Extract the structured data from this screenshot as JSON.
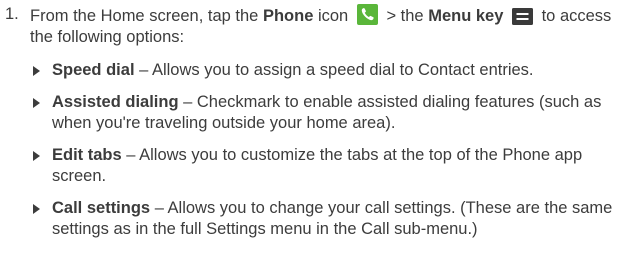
{
  "step": {
    "number": "1.",
    "intro_before_phone": "From the Home screen, tap the",
    "phone_label": "Phone",
    "icon_word": "icon",
    "arrow_text": "> the",
    "menu_key_label": "Menu key",
    "intro_after_menu": "to access the following options:",
    "phone_icon": "phone-icon",
    "menu_icon": "menu-key-icon"
  },
  "colors": {
    "phone_icon_bg": "#5ab63a",
    "menu_icon_bg": "#3a3a3a",
    "text": "#3c3c3c"
  },
  "options": [
    {
      "title": "Speed dial",
      "description": " – Allows you to assign a speed dial to Contact entries."
    },
    {
      "title": "Assisted dialing",
      "description": " – Checkmark to enable assisted dialing features (such as when you're traveling outside your home area)."
    },
    {
      "title": "Edit tabs",
      "description": " – Allows you to customize the tabs at the top of the Phone app screen."
    },
    {
      "title": "Call settings",
      "description": " – Allows you to change your call settings. (These are the same settings as in the full Settings menu in the Call sub-menu.)"
    }
  ]
}
